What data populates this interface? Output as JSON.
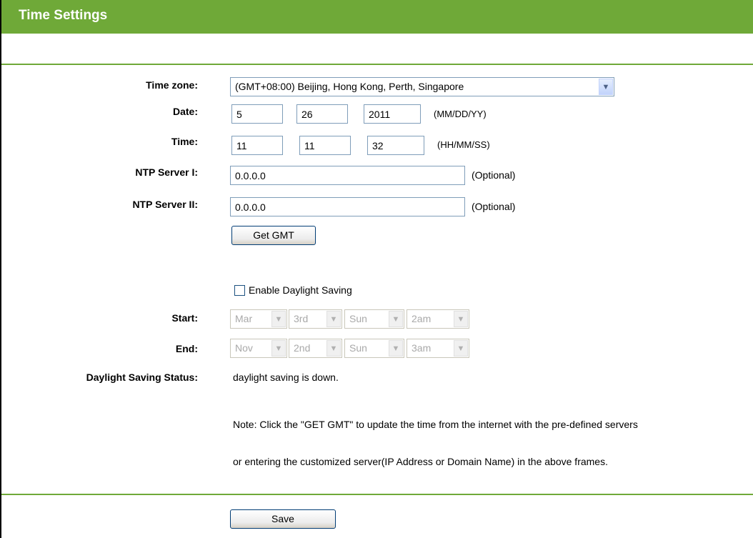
{
  "header": {
    "title": "Time Settings"
  },
  "form": {
    "time_zone": {
      "label": "Time zone:",
      "value": "(GMT+08:00) Beijing, Hong Kong, Perth, Singapore"
    },
    "date": {
      "label": "Date:",
      "month": "5",
      "day": "26",
      "year": "2011",
      "format": "(MM/DD/YY)"
    },
    "time": {
      "label": "Time:",
      "hour": "11",
      "minute": "11",
      "second": "32",
      "format": "(HH/MM/SS)"
    },
    "ntp1": {
      "label": "NTP Server I:",
      "value": "0.0.0.0",
      "hint": "(Optional)"
    },
    "ntp2": {
      "label": "NTP Server II:",
      "value": "0.0.0.0",
      "hint": "(Optional)"
    },
    "get_gmt_label": "Get GMT",
    "daylight": {
      "checkbox_label": "Enable Daylight Saving",
      "checked": false
    },
    "start": {
      "label": "Start:",
      "month": "Mar",
      "week": "3rd",
      "day": "Sun",
      "hour": "2am"
    },
    "end": {
      "label": "End:",
      "month": "Nov",
      "week": "2nd",
      "day": "Sun",
      "hour": "3am"
    },
    "status": {
      "label": "Daylight Saving Status:",
      "value": "daylight saving is down."
    },
    "note_line1": "Note: Click the \"GET GMT\" to update the time from the internet with the pre-defined servers",
    "note_line2": "or entering the customized server(IP Address or Domain Name) in the above frames."
  },
  "footer": {
    "save_label": "Save"
  },
  "colors": {
    "accent": "#6fa938",
    "header_text": "#ffffff"
  }
}
